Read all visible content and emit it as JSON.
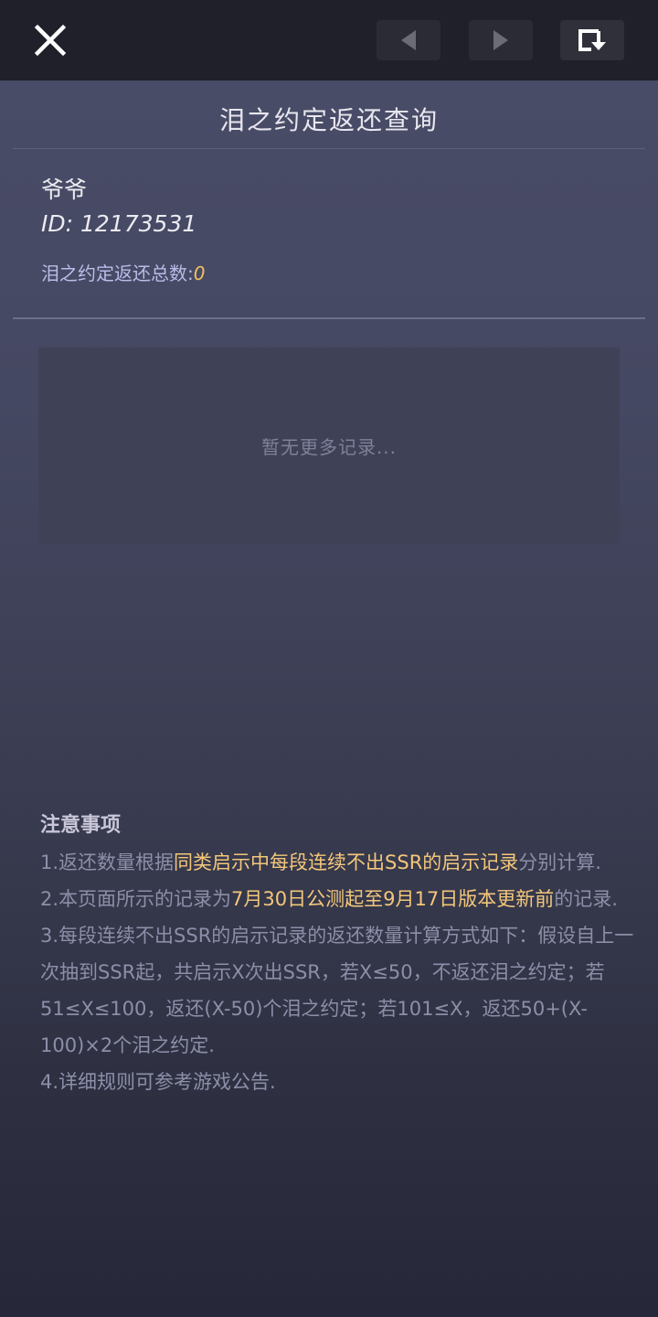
{
  "toolbar": {
    "close_icon": "close-icon",
    "prev_icon": "chevron-left-icon",
    "next_icon": "chevron-right-icon",
    "refresh_icon": "refresh-icon"
  },
  "page": {
    "title": "泪之约定返还查询"
  },
  "player": {
    "name": "爷爷",
    "id_label": "ID: 12173531",
    "total_label": "泪之约定返还总数:",
    "total_value": "0"
  },
  "records": {
    "empty_text": "暂无更多记录..."
  },
  "notes": {
    "title": "注意事项",
    "item1_pre": "1.返还数量根据",
    "item1_hl": "同类启示中每段连续不出SSR的启示记录",
    "item1_post": "分别计算.",
    "item2_pre": "2.本页面所示的记录为",
    "item2_hl": "7月30日公测起至9月17日版本更新前",
    "item2_post": "的记录.",
    "item3": "3.每段连续不出SSR的启示记录的返还数量计算方式如下：假设自上一次抽到SSR起，共启示X次出SSR，若X≤50，不返还泪之约定；若51≤X≤100，返还(X-50)个泪之约定；若101≤X，返还50+(X-100)×2个泪之约定.",
    "item4": "4.详细规则可参考游戏公告."
  },
  "colors": {
    "highlight": "#f3c77a",
    "total_value": "#f0c060",
    "label_blue": "#b9bde8"
  }
}
